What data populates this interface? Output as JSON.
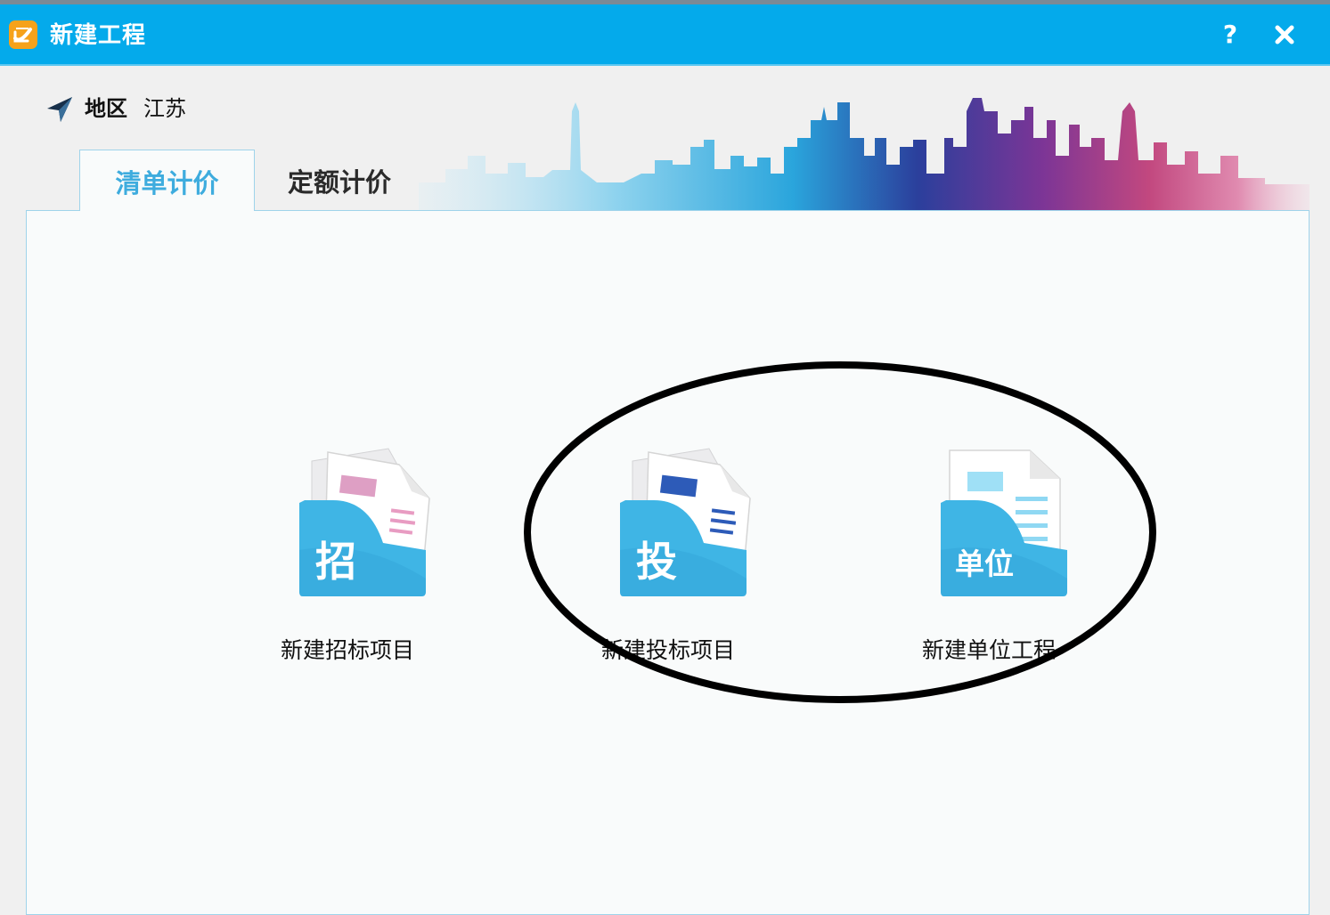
{
  "window": {
    "title": "新建工程",
    "help_label": "?",
    "icons": {
      "app": "app-logo-icon",
      "close": "close-icon"
    },
    "accent_color": "#04aaeb"
  },
  "region": {
    "label": "地区",
    "value": "江苏",
    "icon": "location-arrow-icon"
  },
  "tabs": [
    {
      "label": "清单计价",
      "active": true
    },
    {
      "label": "定额计价",
      "active": false
    }
  ],
  "items": [
    {
      "badge": "招",
      "label": "新建招标项目",
      "icon": "tender-folder-icon"
    },
    {
      "badge": "投",
      "label": "新建投标项目",
      "icon": "bid-folder-icon"
    },
    {
      "badge": "单位",
      "label": "新建单位工程",
      "icon": "unit-project-folder-icon"
    }
  ]
}
